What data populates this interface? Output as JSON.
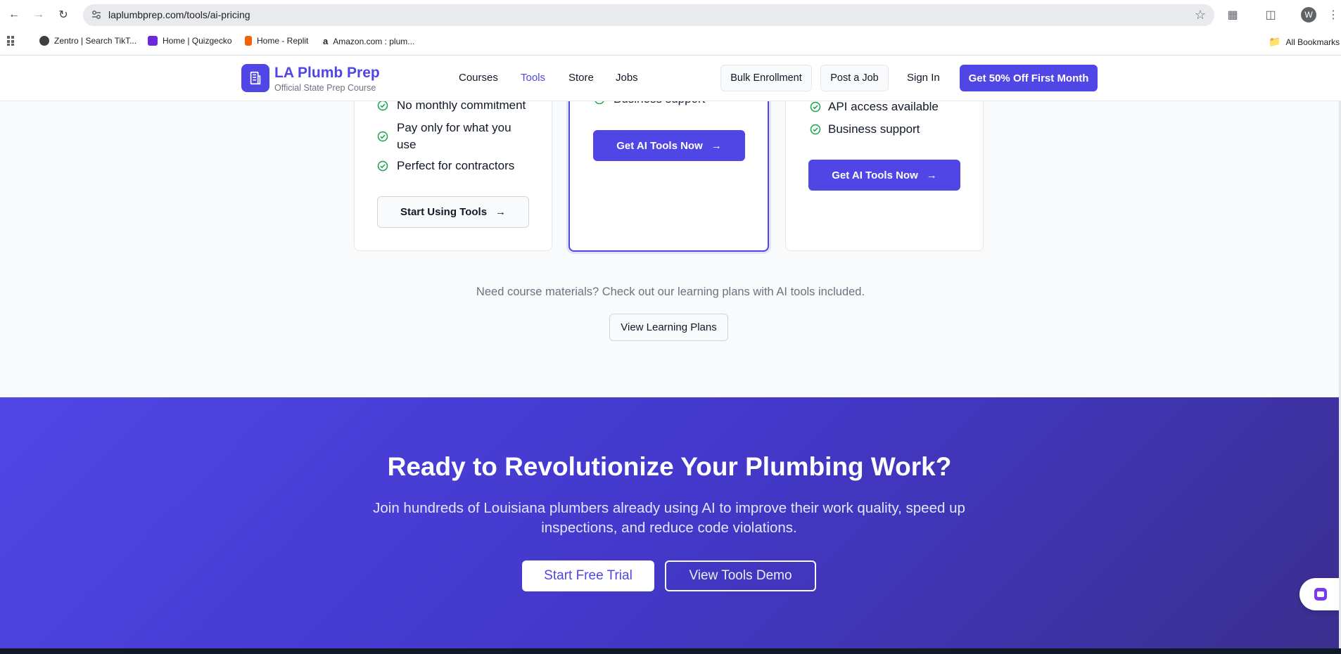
{
  "browser": {
    "url": "laplumbprep.com/tools/ai-pricing",
    "avatar_letter": "W",
    "bookmarks": [
      {
        "label": "Zentro | Search TikT...",
        "icon": "globe-icon",
        "color": "#202124"
      },
      {
        "label": "Home | Quizgecko",
        "icon": "quizgecko-icon",
        "color": "#6d28d9"
      },
      {
        "label": "Home - Replit",
        "icon": "replit-icon",
        "color": "#f26207"
      },
      {
        "label": "Amazon.com : plum...",
        "icon": "amazon-icon",
        "color": "#111111"
      }
    ],
    "all_bookmarks": "All Bookmarks"
  },
  "header": {
    "logo_title": "LA Plumb Prep",
    "logo_subtitle": "Official State Prep Course",
    "nav": [
      "Courses",
      "Tools",
      "Store",
      "Jobs"
    ],
    "active_nav": "Tools",
    "bulk_enrollment": "Bulk Enrollment",
    "post_job": "Post a Job",
    "sign_in": "Sign In",
    "cta": "Get 50% Off First Month"
  },
  "cards": [
    {
      "features": [
        "No monthly commitment",
        "Pay only for what you use",
        "Perfect for contractors"
      ],
      "button": "Start Using Tools"
    },
    {
      "features": [
        "Business support"
      ],
      "button": "Get AI Tools Now"
    },
    {
      "features": [
        "API access available",
        "Business support"
      ],
      "button": "Get AI Tools Now"
    }
  ],
  "note": "Need course materials? Check out our learning plans with AI tools included.",
  "plans_button": "View Learning Plans",
  "hero": {
    "title": "Ready to Revolutionize Your Plumbing Work?",
    "subtitle": "Join hundreds of Louisiana plumbers already using AI to improve their work quality, speed up inspections, and reduce code violations.",
    "primary_button": "Start Free Trial",
    "secondary_button": "View Tools Demo"
  },
  "colors": {
    "brand": "#4f46e5",
    "check": "#16a34a"
  }
}
